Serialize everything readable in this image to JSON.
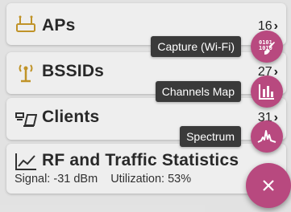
{
  "rows": [
    {
      "icon": "ap-icon",
      "label": "APs",
      "count": "16"
    },
    {
      "icon": "antenna-icon",
      "label": "BSSIDs",
      "count": "27"
    },
    {
      "icon": "clients-icon",
      "label": "Clients",
      "count": "31"
    },
    {
      "icon": "chart-line-icon",
      "label": "RF and Traffic Statistics",
      "signal": "Signal: -31 dBm",
      "utilization": "Utilization: 53%"
    }
  ],
  "fab_menu": [
    {
      "label": "Capture (Wi-Fi)",
      "icon": "capture-wifi-icon"
    },
    {
      "label": "Channels Map",
      "icon": "channels-map-icon"
    },
    {
      "label": "Spectrum",
      "icon": "spectrum-icon"
    }
  ],
  "fab": {
    "icon": "close-icon",
    "symbol": "×"
  },
  "colors": {
    "accent": "#b8497f",
    "icon_gold": "#c89a2a",
    "tooltip": "#3a3a3a"
  }
}
